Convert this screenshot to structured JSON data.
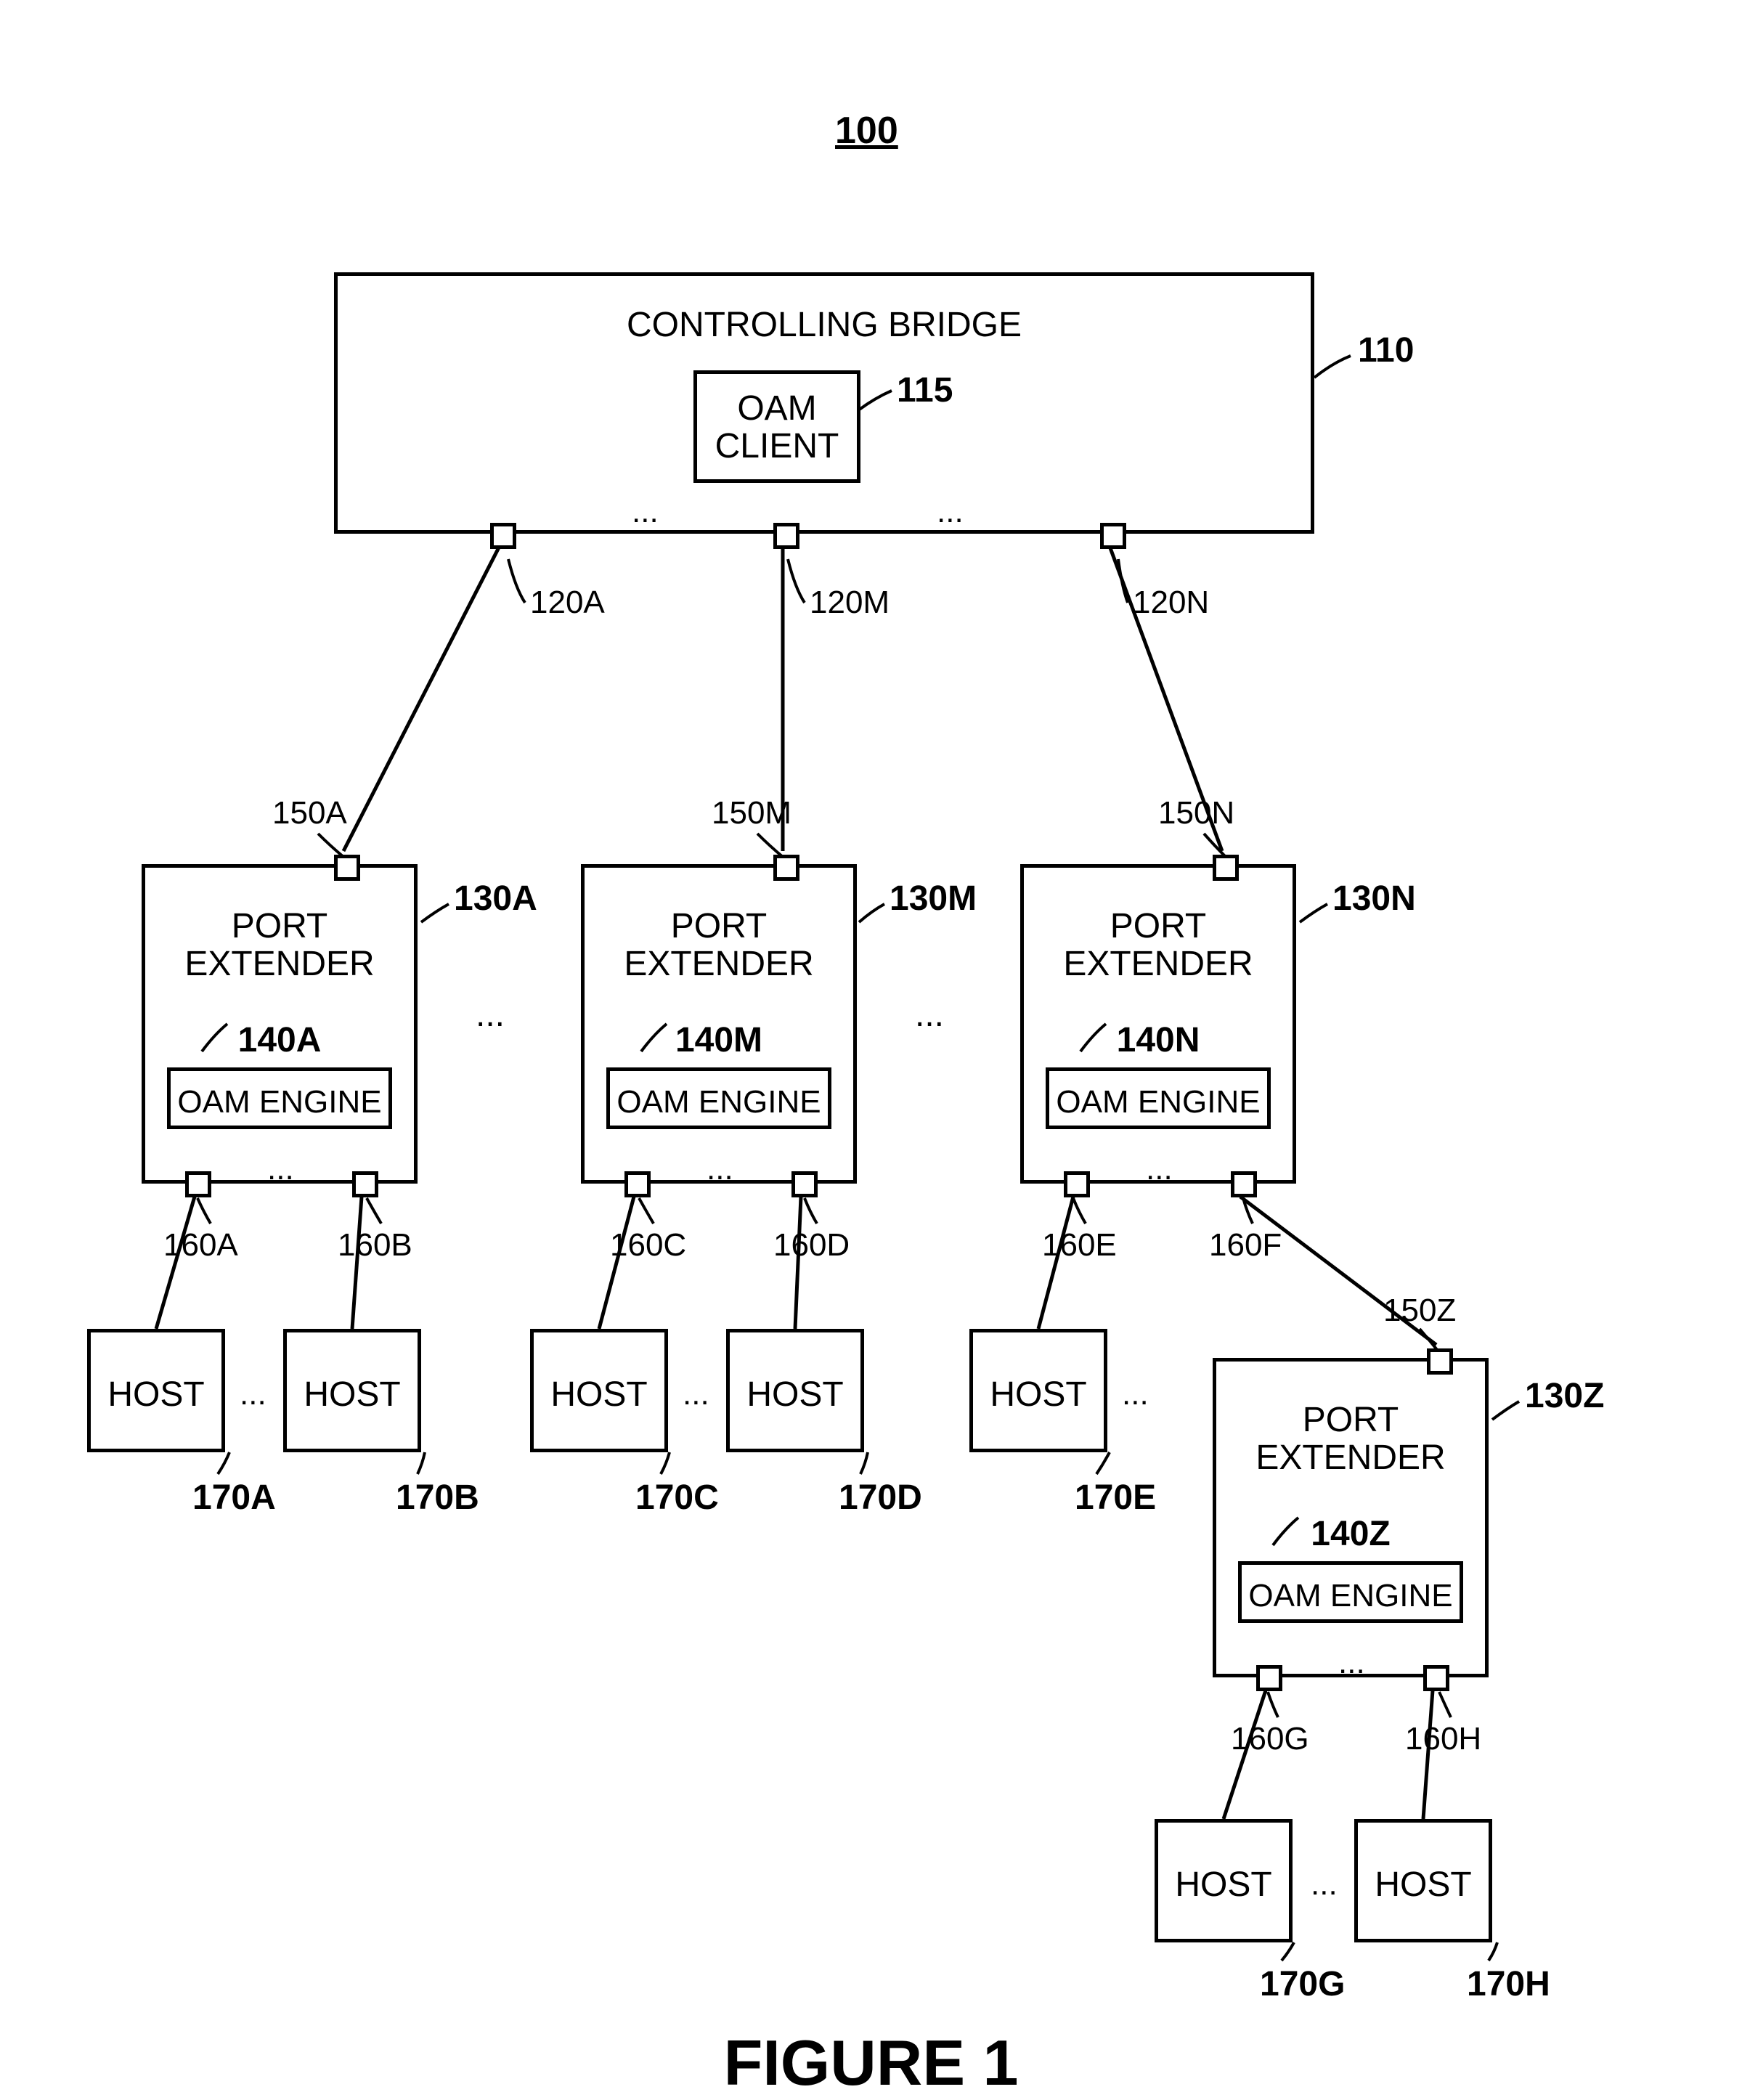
{
  "figure_number_label": "100",
  "figure_caption": "FIGURE 1",
  "bridge": {
    "title": "CONTROLLING BRIDGE",
    "ref": "110",
    "oam_client": {
      "label": "OAM\nCLIENT",
      "ref": "115"
    },
    "ports": {
      "a": "120A",
      "m": "120M",
      "n": "120N"
    },
    "ellipsis_am": "...",
    "ellipsis_mn": "..."
  },
  "extenders": {
    "a": {
      "title": "PORT\nEXTENDER",
      "ref": "130A",
      "uplink": "150A",
      "oam_ref": "140A",
      "oam_label": "OAM ENGINE",
      "down_ports": {
        "left": "160A",
        "right": "160B"
      },
      "down_ellipsis": "..."
    },
    "m": {
      "title": "PORT\nEXTENDER",
      "ref": "130M",
      "uplink": "150M",
      "oam_ref": "140M",
      "oam_label": "OAM ENGINE",
      "down_ports": {
        "left": "160C",
        "right": "160D"
      },
      "down_ellipsis": "..."
    },
    "n": {
      "title": "PORT\nEXTENDER",
      "ref": "130N",
      "uplink": "150N",
      "oam_ref": "140N",
      "oam_label": "OAM ENGINE",
      "down_ports": {
        "left": "160E",
        "right": "160F"
      },
      "down_ellipsis": "..."
    },
    "z": {
      "title": "PORT\nEXTENDER",
      "ref": "130Z",
      "uplink": "150Z",
      "oam_ref": "140Z",
      "oam_label": "OAM ENGINE",
      "down_ports": {
        "left": "160G",
        "right": "160H"
      },
      "down_ellipsis": "..."
    },
    "row_ellipsis_am": "...",
    "row_ellipsis_mn": "..."
  },
  "hosts": {
    "a": {
      "label": "HOST",
      "ref": "170A"
    },
    "b": {
      "label": "HOST",
      "ref": "170B"
    },
    "c": {
      "label": "HOST",
      "ref": "170C"
    },
    "d": {
      "label": "HOST",
      "ref": "170D"
    },
    "e": {
      "label": "HOST",
      "ref": "170E"
    },
    "g": {
      "label": "HOST",
      "ref": "170G"
    },
    "h": {
      "label": "HOST",
      "ref": "170H"
    },
    "ellipsis_ab": "...",
    "ellipsis_cd": "...",
    "ellipsis_e": "...",
    "ellipsis_gh": "..."
  }
}
